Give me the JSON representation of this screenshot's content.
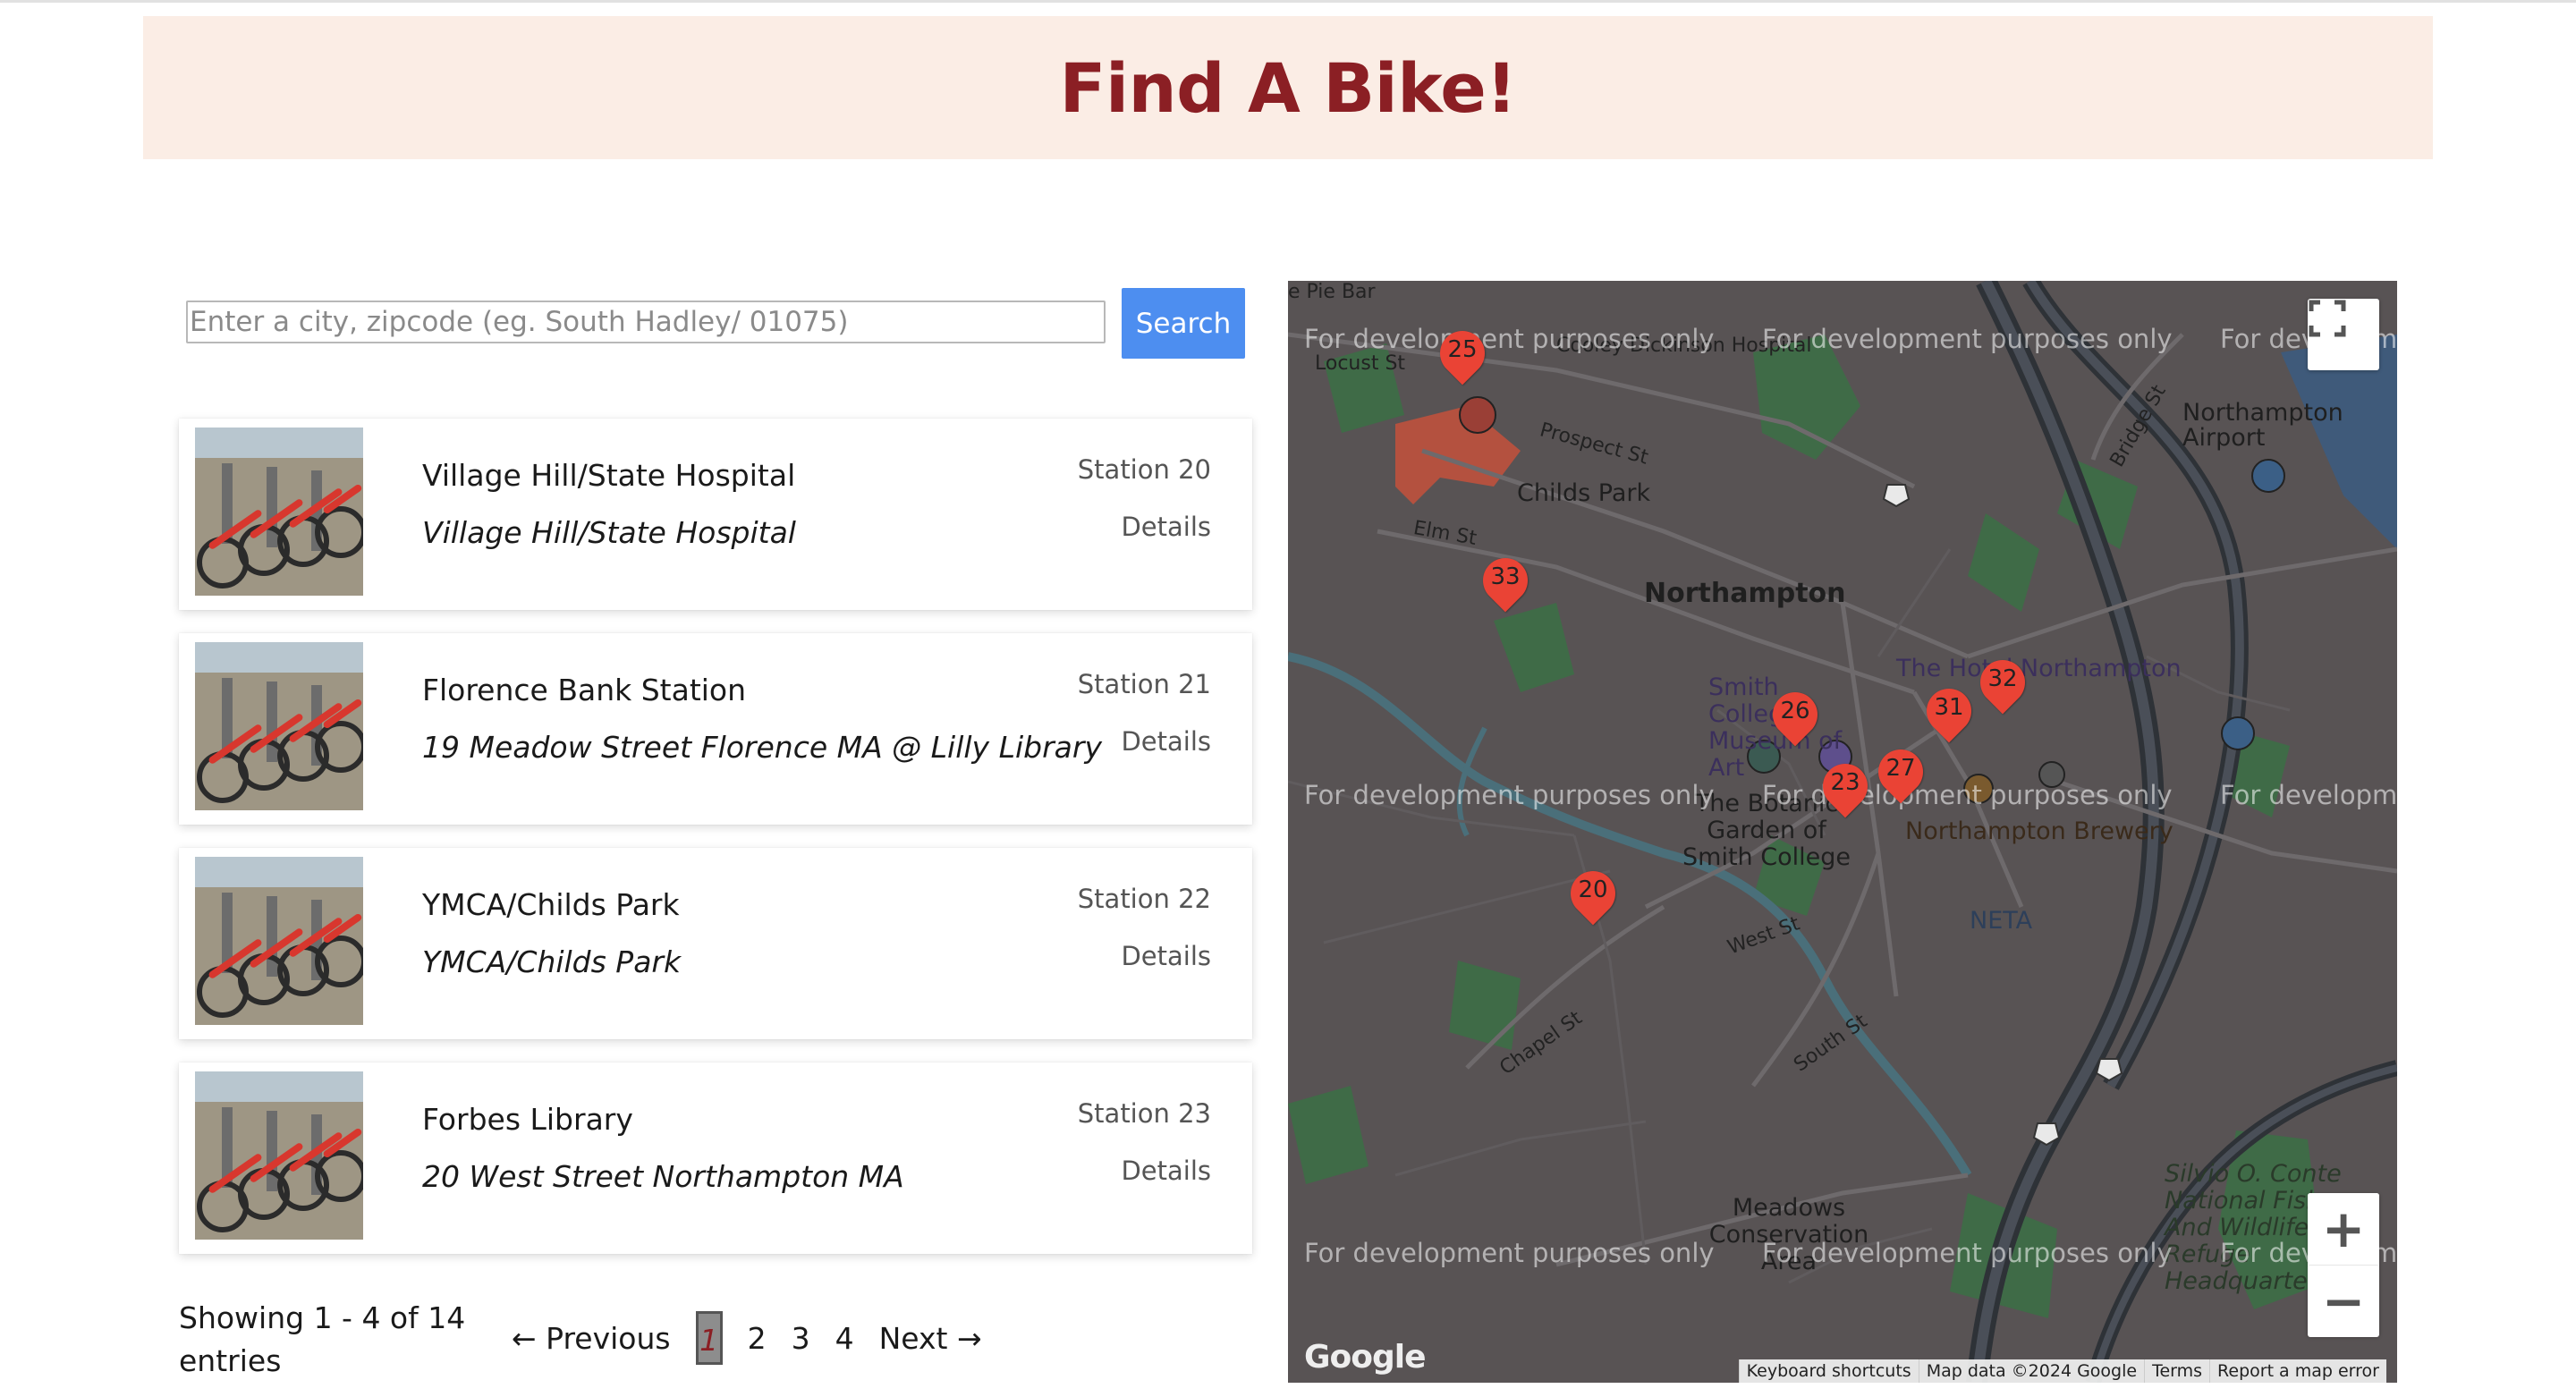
{
  "header": {
    "title": "Find A Bike!"
  },
  "search": {
    "placeholder": "Enter a city, zipcode (eg. South Hadley/ 01075)",
    "value": "",
    "button": "Search"
  },
  "stations": [
    {
      "name": "Village Hill/State Hospital",
      "address": "Village Hill/State Hospital",
      "station": "Station 20",
      "details": "Details"
    },
    {
      "name": "Florence Bank Station",
      "address": "19 Meadow Street Florence MA @ Lilly Library",
      "station": "Station 21",
      "details": "Details"
    },
    {
      "name": "YMCA/Childs Park",
      "address": "YMCA/Childs Park",
      "station": "Station 22",
      "details": "Details"
    },
    {
      "name": "Forbes Library",
      "address": "20 West Street Northampton MA",
      "station": "Station 23",
      "details": "Details"
    }
  ],
  "pagination": {
    "showing": "Showing 1 - 4 of 14 entries",
    "previous": "← Previous",
    "pages": [
      "1",
      "2",
      "3",
      "4"
    ],
    "current": "1",
    "next": "Next →"
  },
  "map": {
    "watermark": "For development purposes only",
    "fullscreen_icon": "fullscreen-icon",
    "zoom_in": "+",
    "zoom_out": "−",
    "logo": "Google",
    "attribution": [
      "Keyboard shortcuts",
      "Map data ©2024 Google",
      "Terms",
      "Report a map error"
    ],
    "markers": [
      "25",
      "33",
      "26",
      "31",
      "32",
      "27",
      "23",
      "20"
    ],
    "labels": {
      "town": "Northampton",
      "childs_park": "Childs Park",
      "airport": "Northampton Airport",
      "smith_museum": "Smith College Museum of Art",
      "hotel": "The Hotel Northampton",
      "garden": "The Botanic Garden of Smith College",
      "brewery": "Northampton Brewery",
      "neta": "NETA",
      "meadows": "Meadows Conservation Area",
      "conte": "Silvio O. Conte National Fish And Wildlife Refuge Headquarters",
      "pie_bar": "e Pie Bar",
      "prospect": "Prospect St",
      "locust": "Locust St",
      "elm": "Elm St",
      "west": "West St",
      "chapel": "Chapel St",
      "south": "South St",
      "bridge": "Bridge St",
      "dickinson": "Cooley Dickinson Hospital"
    }
  }
}
